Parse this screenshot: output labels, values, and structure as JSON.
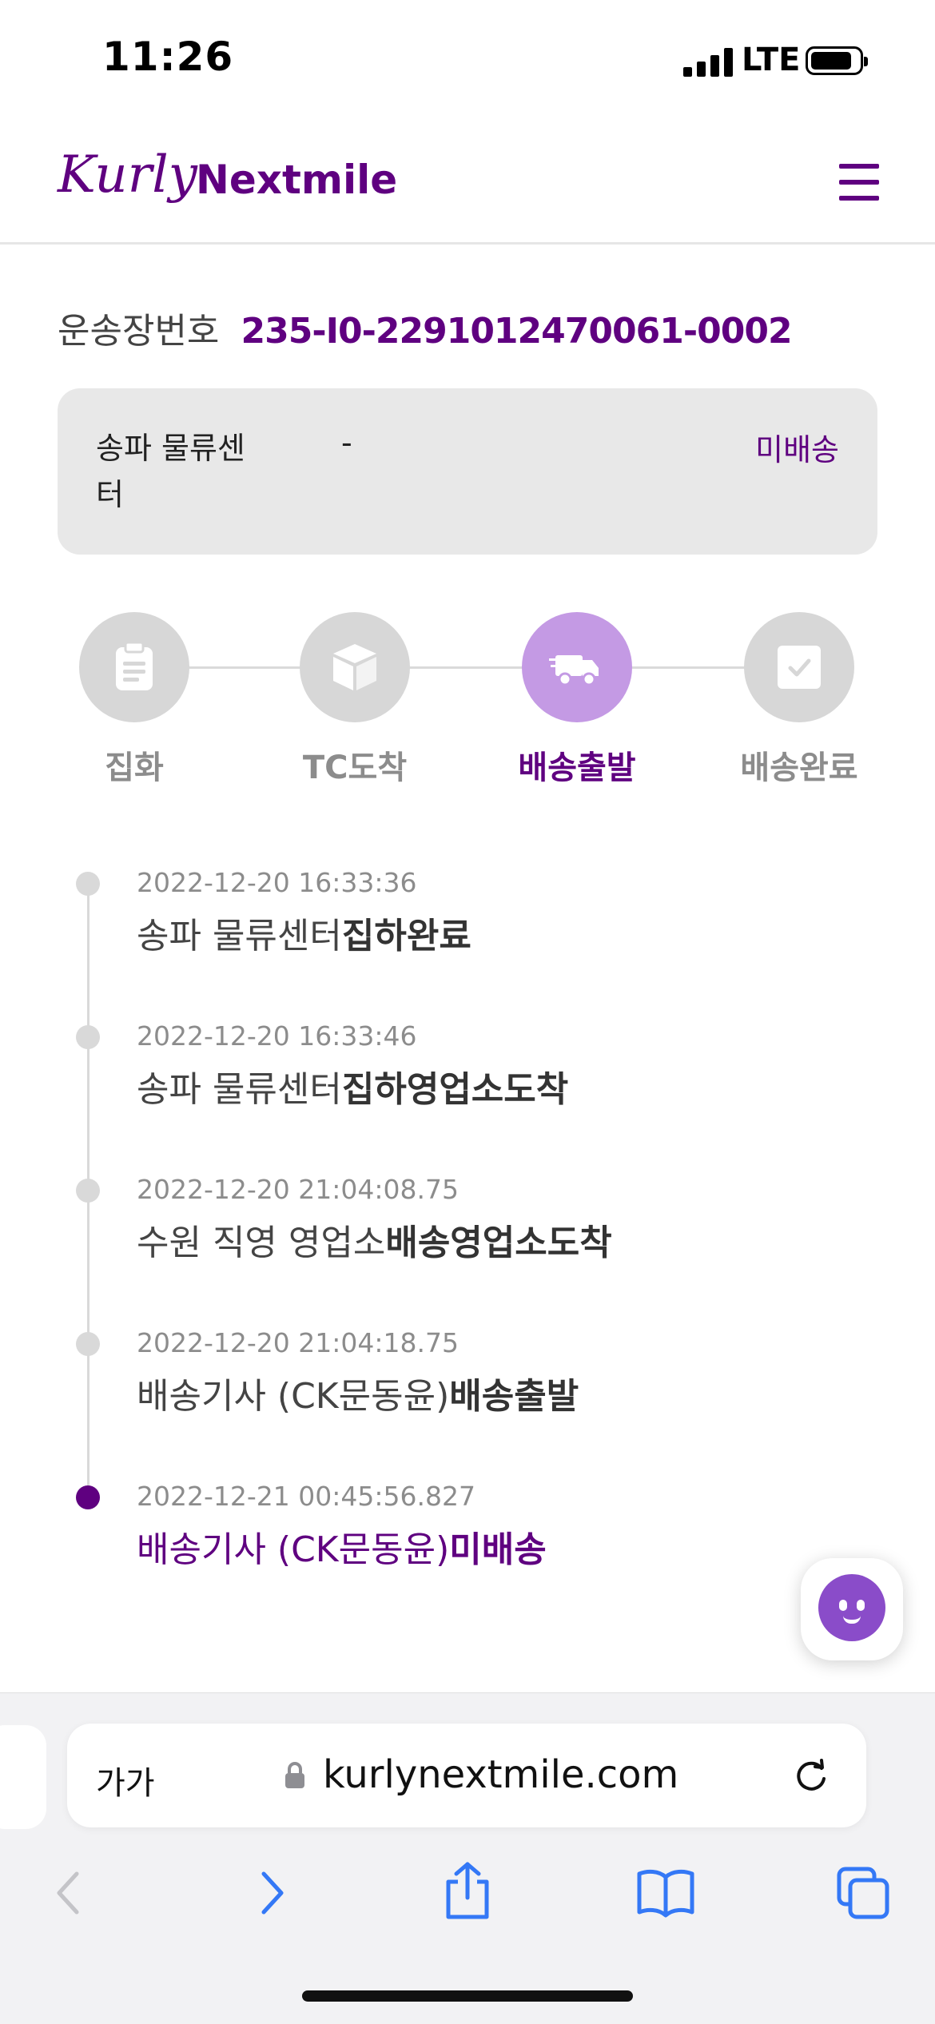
{
  "status_bar": {
    "time": "11:26",
    "carrier": "LTE"
  },
  "header": {
    "logo_script": "Kurly",
    "logo_text": "Nextmile",
    "menu_icon": "hamburger-menu-icon"
  },
  "waybill": {
    "label": "운송장번호",
    "number": "235-I0-2291012470061-0002"
  },
  "info_card": {
    "center": "송파 물류센터",
    "dash": "-",
    "status": "미배송"
  },
  "steps": [
    {
      "label": "집화",
      "icon": "clipboard-icon",
      "active": false
    },
    {
      "label": "TC도착",
      "icon": "box-icon",
      "active": false
    },
    {
      "label": "배송출발",
      "icon": "truck-icon",
      "active": true
    },
    {
      "label": "배송완료",
      "icon": "check-icon",
      "active": false
    }
  ],
  "timeline": [
    {
      "timestamp": "2022-12-20 16:33:36",
      "place": "송파 물류센터",
      "action": "집하완료"
    },
    {
      "timestamp": "2022-12-20 16:33:46",
      "place": "송파 물류센터",
      "action": "집하영업소도착"
    },
    {
      "timestamp": "2022-12-20 21:04:08.75",
      "place": "수원 직영 영업소",
      "action": "배송영업소도착"
    },
    {
      "timestamp": "2022-12-20 21:04:18.75",
      "place": "배송기사 (CK문동윤)",
      "action": "배송출발"
    },
    {
      "timestamp": "2022-12-21 00:45:56.827",
      "place": "배송기사 (CK문동윤)",
      "action": "미배송"
    }
  ],
  "browser": {
    "text_size_label": "가가",
    "url": "kurlynextmile.com"
  },
  "colors": {
    "brand": "#5f0080",
    "active_step": "#c49ae4",
    "inactive_step": "#d7d7d7",
    "link_blue": "#3478f6"
  }
}
